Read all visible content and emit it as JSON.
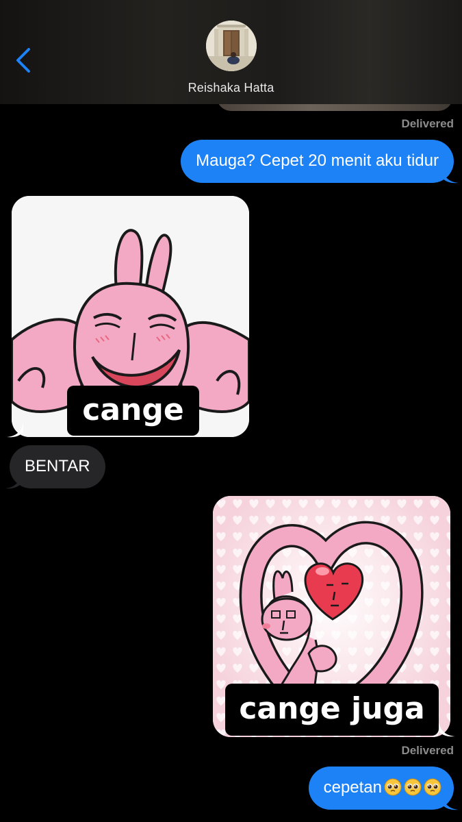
{
  "header": {
    "back_icon": "chevron-left-icon",
    "contact_name": "Reishaka Hatta",
    "avatar": "contact-avatar"
  },
  "messages": [
    {
      "id": "m1",
      "type": "text",
      "direction": "sent",
      "text": "Mauga? Cepet 20 menit aku tidur"
    },
    {
      "id": "m2",
      "type": "image",
      "direction": "received",
      "caption": "cange",
      "image": "pink-bunny-smirking-sticker"
    },
    {
      "id": "m3",
      "type": "text",
      "direction": "received",
      "text": "BENTAR"
    },
    {
      "id": "m4",
      "type": "image",
      "direction": "sent",
      "caption": "cange juga",
      "image": "pink-bunny-heart-sticker"
    },
    {
      "id": "m5",
      "type": "text",
      "direction": "sent",
      "text": "cepetan",
      "emoji": [
        "pleading-face",
        "pleading-face",
        "pleading-face"
      ]
    }
  ],
  "status": {
    "top": "Delivered",
    "bottom": "Delivered"
  },
  "colors": {
    "sent_bubble": "#1e82f7",
    "received_bubble": "#262628",
    "background": "#000000",
    "accent": "#1e82f7"
  }
}
